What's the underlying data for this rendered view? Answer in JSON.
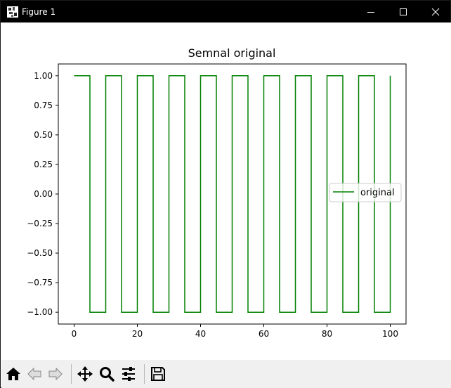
{
  "window": {
    "title": "Figure 1"
  },
  "toolbar": {
    "buttons": [
      "home-icon",
      "back-icon",
      "forward-icon",
      "pan-icon",
      "zoom-icon",
      "configure-subplots-icon",
      "save-icon"
    ]
  },
  "colors": {
    "series": "#008000",
    "titlebar": "#000000",
    "toolbar": "#f0f0f0"
  },
  "chart_data": {
    "type": "line",
    "title": "Semnal original",
    "xlabel": "",
    "ylabel": "",
    "xlim": [
      -5,
      105
    ],
    "ylim": [
      -1.1,
      1.1
    ],
    "xticks": [
      0,
      20,
      40,
      60,
      80,
      100
    ],
    "xtick_labels": [
      "0",
      "20",
      "40",
      "60",
      "80",
      "100"
    ],
    "yticks": [
      1.0,
      0.75,
      0.5,
      0.25,
      0.0,
      -0.25,
      -0.5,
      -0.75,
      -1.0
    ],
    "ytick_labels": [
      "1.00",
      "0.75",
      "0.50",
      "0.25",
      "0.00",
      "−0.25",
      "−0.50",
      "−0.75",
      "−1.00"
    ],
    "grid": false,
    "legend": {
      "position": "center-right",
      "entries": [
        "original"
      ]
    },
    "series": [
      {
        "name": "original",
        "color": "#008000",
        "x": [
          0,
          5,
          5,
          10,
          10,
          15,
          15,
          20,
          20,
          25,
          25,
          30,
          30,
          35,
          35,
          40,
          40,
          45,
          45,
          50,
          50,
          55,
          55,
          60,
          60,
          65,
          65,
          70,
          70,
          75,
          75,
          80,
          80,
          85,
          85,
          90,
          90,
          95,
          95,
          100,
          100
        ],
        "y": [
          1,
          1,
          -1,
          -1,
          1,
          1,
          -1,
          -1,
          1,
          1,
          -1,
          -1,
          1,
          1,
          -1,
          -1,
          1,
          1,
          -1,
          -1,
          1,
          1,
          -1,
          -1,
          1,
          1,
          -1,
          -1,
          1,
          1,
          -1,
          -1,
          1,
          1,
          -1,
          -1,
          1,
          1,
          -1,
          -1,
          1
        ]
      }
    ]
  }
}
